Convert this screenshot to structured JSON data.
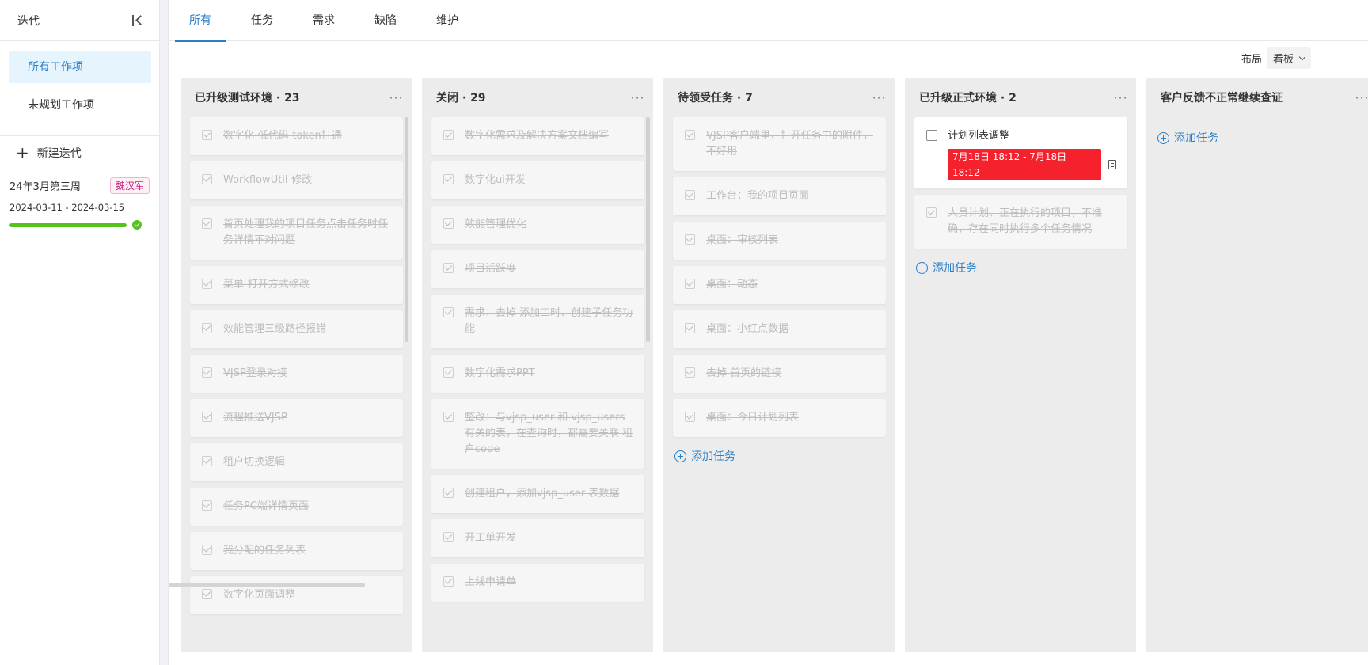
{
  "sidebar": {
    "title": "迭代",
    "nav": [
      {
        "label": "所有工作项",
        "active": true
      },
      {
        "label": "未规划工作项",
        "active": false
      }
    ],
    "new_iteration": "新建迭代",
    "iteration": {
      "name": "24年3月第三周",
      "owner": "魏汉军",
      "dates": "2024-03-11 - 2024-03-15",
      "progress": 1.0
    }
  },
  "tabs": [
    {
      "label": "所有",
      "active": true
    },
    {
      "label": "任务",
      "active": false
    },
    {
      "label": "需求",
      "active": false
    },
    {
      "label": "缺陷",
      "active": false
    },
    {
      "label": "维护",
      "active": false
    }
  ],
  "layout": {
    "label": "布局",
    "value": "看板"
  },
  "add_task_label": "添加任务",
  "columns": [
    {
      "title": "已升级测试环境 · 23",
      "cards": [
        {
          "text": "数字化-低代码-token打通",
          "done": true
        },
        {
          "text": "WorkflowUtil-修改",
          "done": true
        },
        {
          "text": "首页处理我的项目任务点击任务时任务详情不对问题",
          "done": true
        },
        {
          "text": "菜单-打开方式修改",
          "done": true
        },
        {
          "text": "效能管理三级路径报错",
          "done": true
        },
        {
          "text": "VJSP登录对接",
          "done": true
        },
        {
          "text": "流程推送VJSP",
          "done": true
        },
        {
          "text": "租户切换逻辑",
          "done": true
        },
        {
          "text": "任务PC端详情页面",
          "done": true
        },
        {
          "text": "我分配的任务列表",
          "done": true
        },
        {
          "text": "数字化页面调整",
          "done": true
        }
      ]
    },
    {
      "title": "关闭 · 29",
      "cards": [
        {
          "text": "数字化需求及解决方案文档编写",
          "done": true
        },
        {
          "text": "数字化ui开发",
          "done": true
        },
        {
          "text": "效能管理优化",
          "done": true
        },
        {
          "text": "项目活跃度",
          "done": true
        },
        {
          "text": "需求：去掉 添加工时、创建子任务功能",
          "done": true
        },
        {
          "text": "数字化需求PPT",
          "done": true
        },
        {
          "text": "整改：与vjsp_user 和 vjsp_users 有关的表，在查询时，都需要关联 租户code",
          "done": true
        },
        {
          "text": "创建租户，添加vjsp_user 表数据",
          "done": true
        },
        {
          "text": "开工单开发",
          "done": true
        },
        {
          "text": "上线申请单",
          "done": true
        }
      ]
    },
    {
      "title": "待领受任务 · 7",
      "cards": [
        {
          "text": "VJSP客户端里，打开任务中的附件，不好用",
          "done": true
        },
        {
          "text": "工作台：我的项目页面",
          "done": true
        },
        {
          "text": "桌面：审核列表",
          "done": true
        },
        {
          "text": "桌面：动态",
          "done": true
        },
        {
          "text": "桌面：小红点数据",
          "done": true
        },
        {
          "text": "去掉 首页的链接",
          "done": true
        },
        {
          "text": "桌面：今日计划列表",
          "done": true
        }
      ]
    },
    {
      "title": "已升级正式环境 · 2",
      "cards": [
        {
          "text": "计划列表调整",
          "done": false,
          "date": "7月18日 18:12 - 7月18日 18:12"
        },
        {
          "text": "人员计划、正在执行的项目，不准确，存在同时执行多个任务情况",
          "done": true
        }
      ]
    },
    {
      "title": "客户反馈不正常继续查证",
      "cards": []
    }
  ]
}
